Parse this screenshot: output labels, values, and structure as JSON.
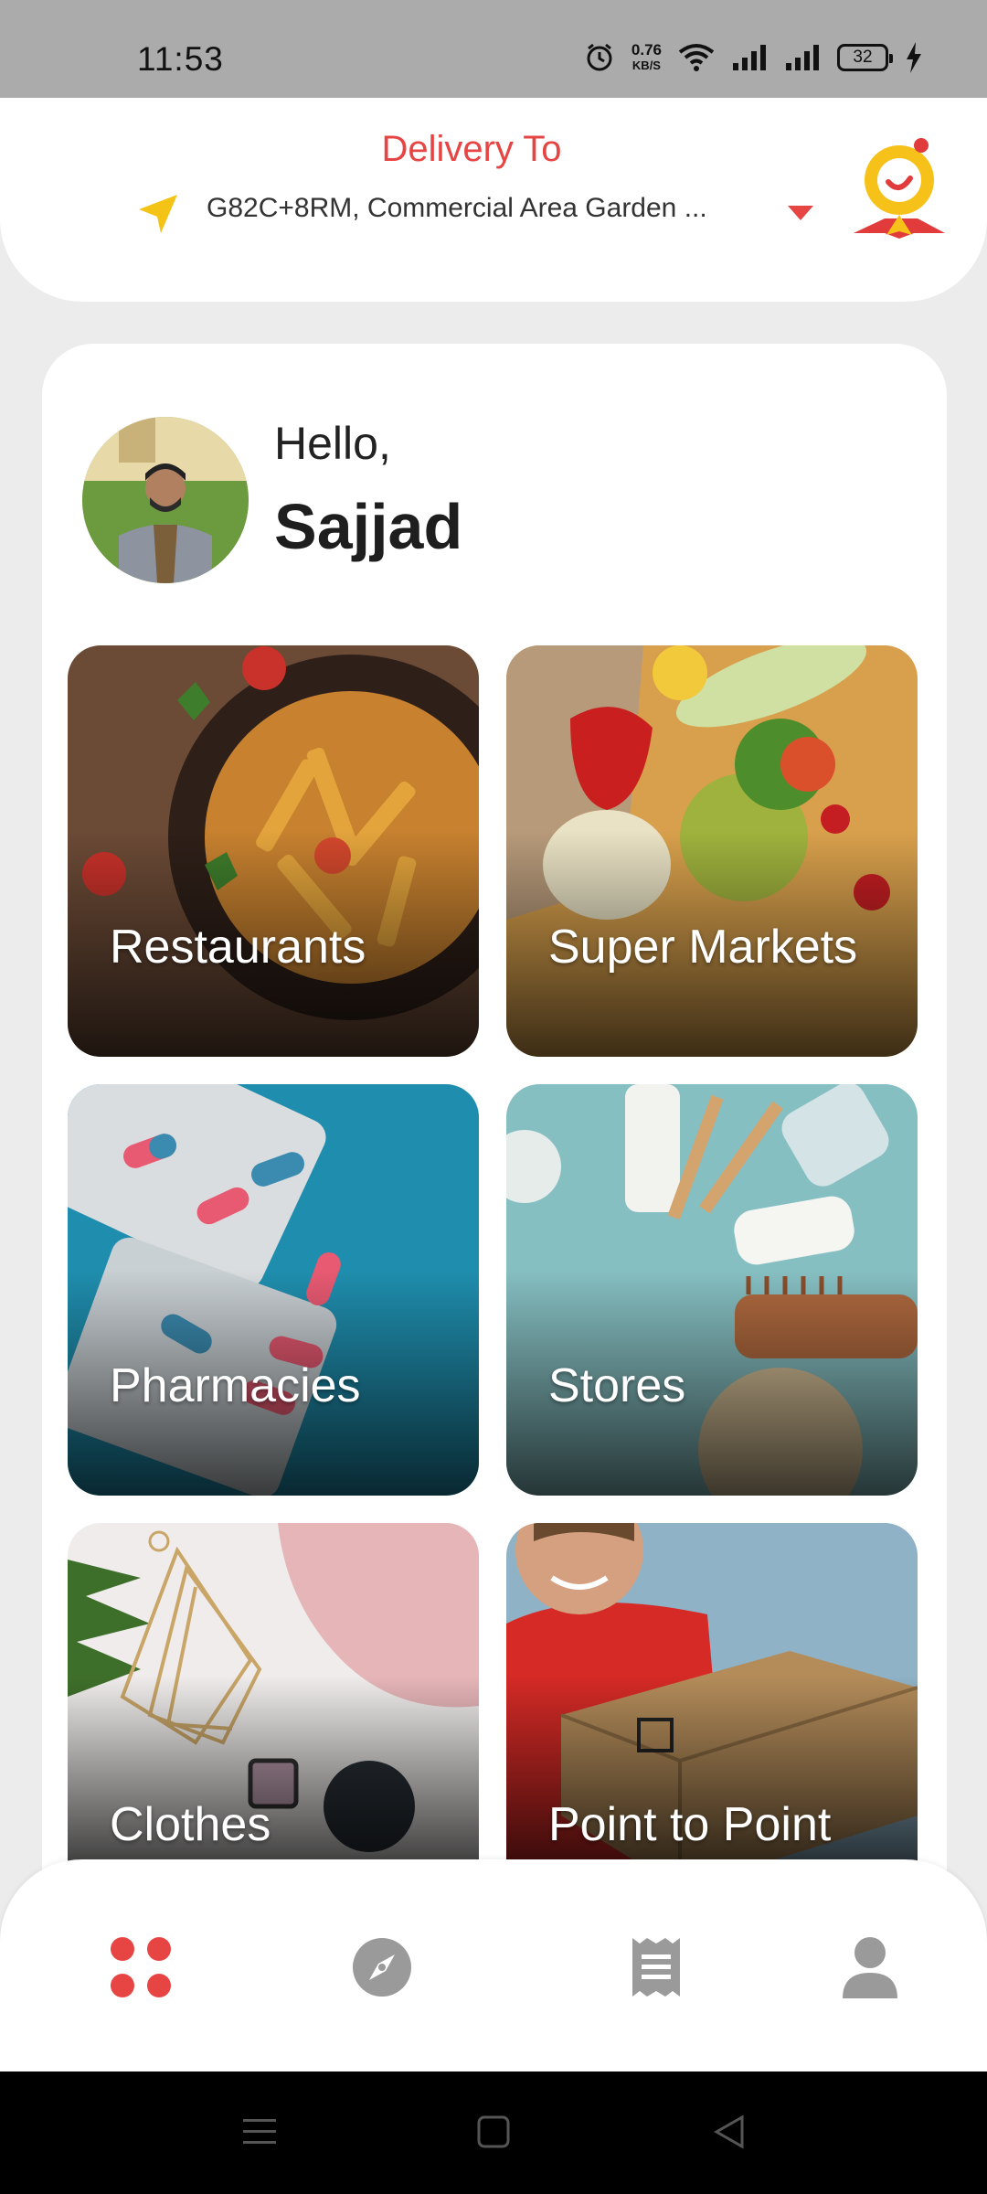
{
  "status_bar": {
    "time": "11:53",
    "net_speed_value": "0.76",
    "net_speed_unit": "KB/S",
    "battery": "32"
  },
  "header": {
    "delivery_title": "Delivery To",
    "address": "G82C+8RM, Commercial Area Garden ...",
    "logo_icon": "map-pin-logo-icon"
  },
  "greeting": {
    "hello": "Hello,",
    "name": "Sajjad"
  },
  "categories": [
    {
      "label": "Restaurants",
      "icon": "pasta-photo"
    },
    {
      "label": "Super Markets",
      "icon": "vegetables-photo"
    },
    {
      "label": "Pharmacies",
      "icon": "pills-photo"
    },
    {
      "label": "Stores",
      "icon": "toiletries-photo"
    },
    {
      "label": "Clothes",
      "icon": "accessories-photo"
    },
    {
      "label": "Point to Point",
      "icon": "courier-box-photo"
    }
  ],
  "bottom_nav": [
    {
      "icon": "grid-icon",
      "active": true
    },
    {
      "icon": "compass-icon",
      "active": false
    },
    {
      "icon": "receipt-icon",
      "active": false
    },
    {
      "icon": "profile-icon",
      "active": false
    }
  ],
  "colors": {
    "accent": "#e64543",
    "logo_yellow": "#f6c21a",
    "inactive_icon": "#9a9a9a"
  }
}
